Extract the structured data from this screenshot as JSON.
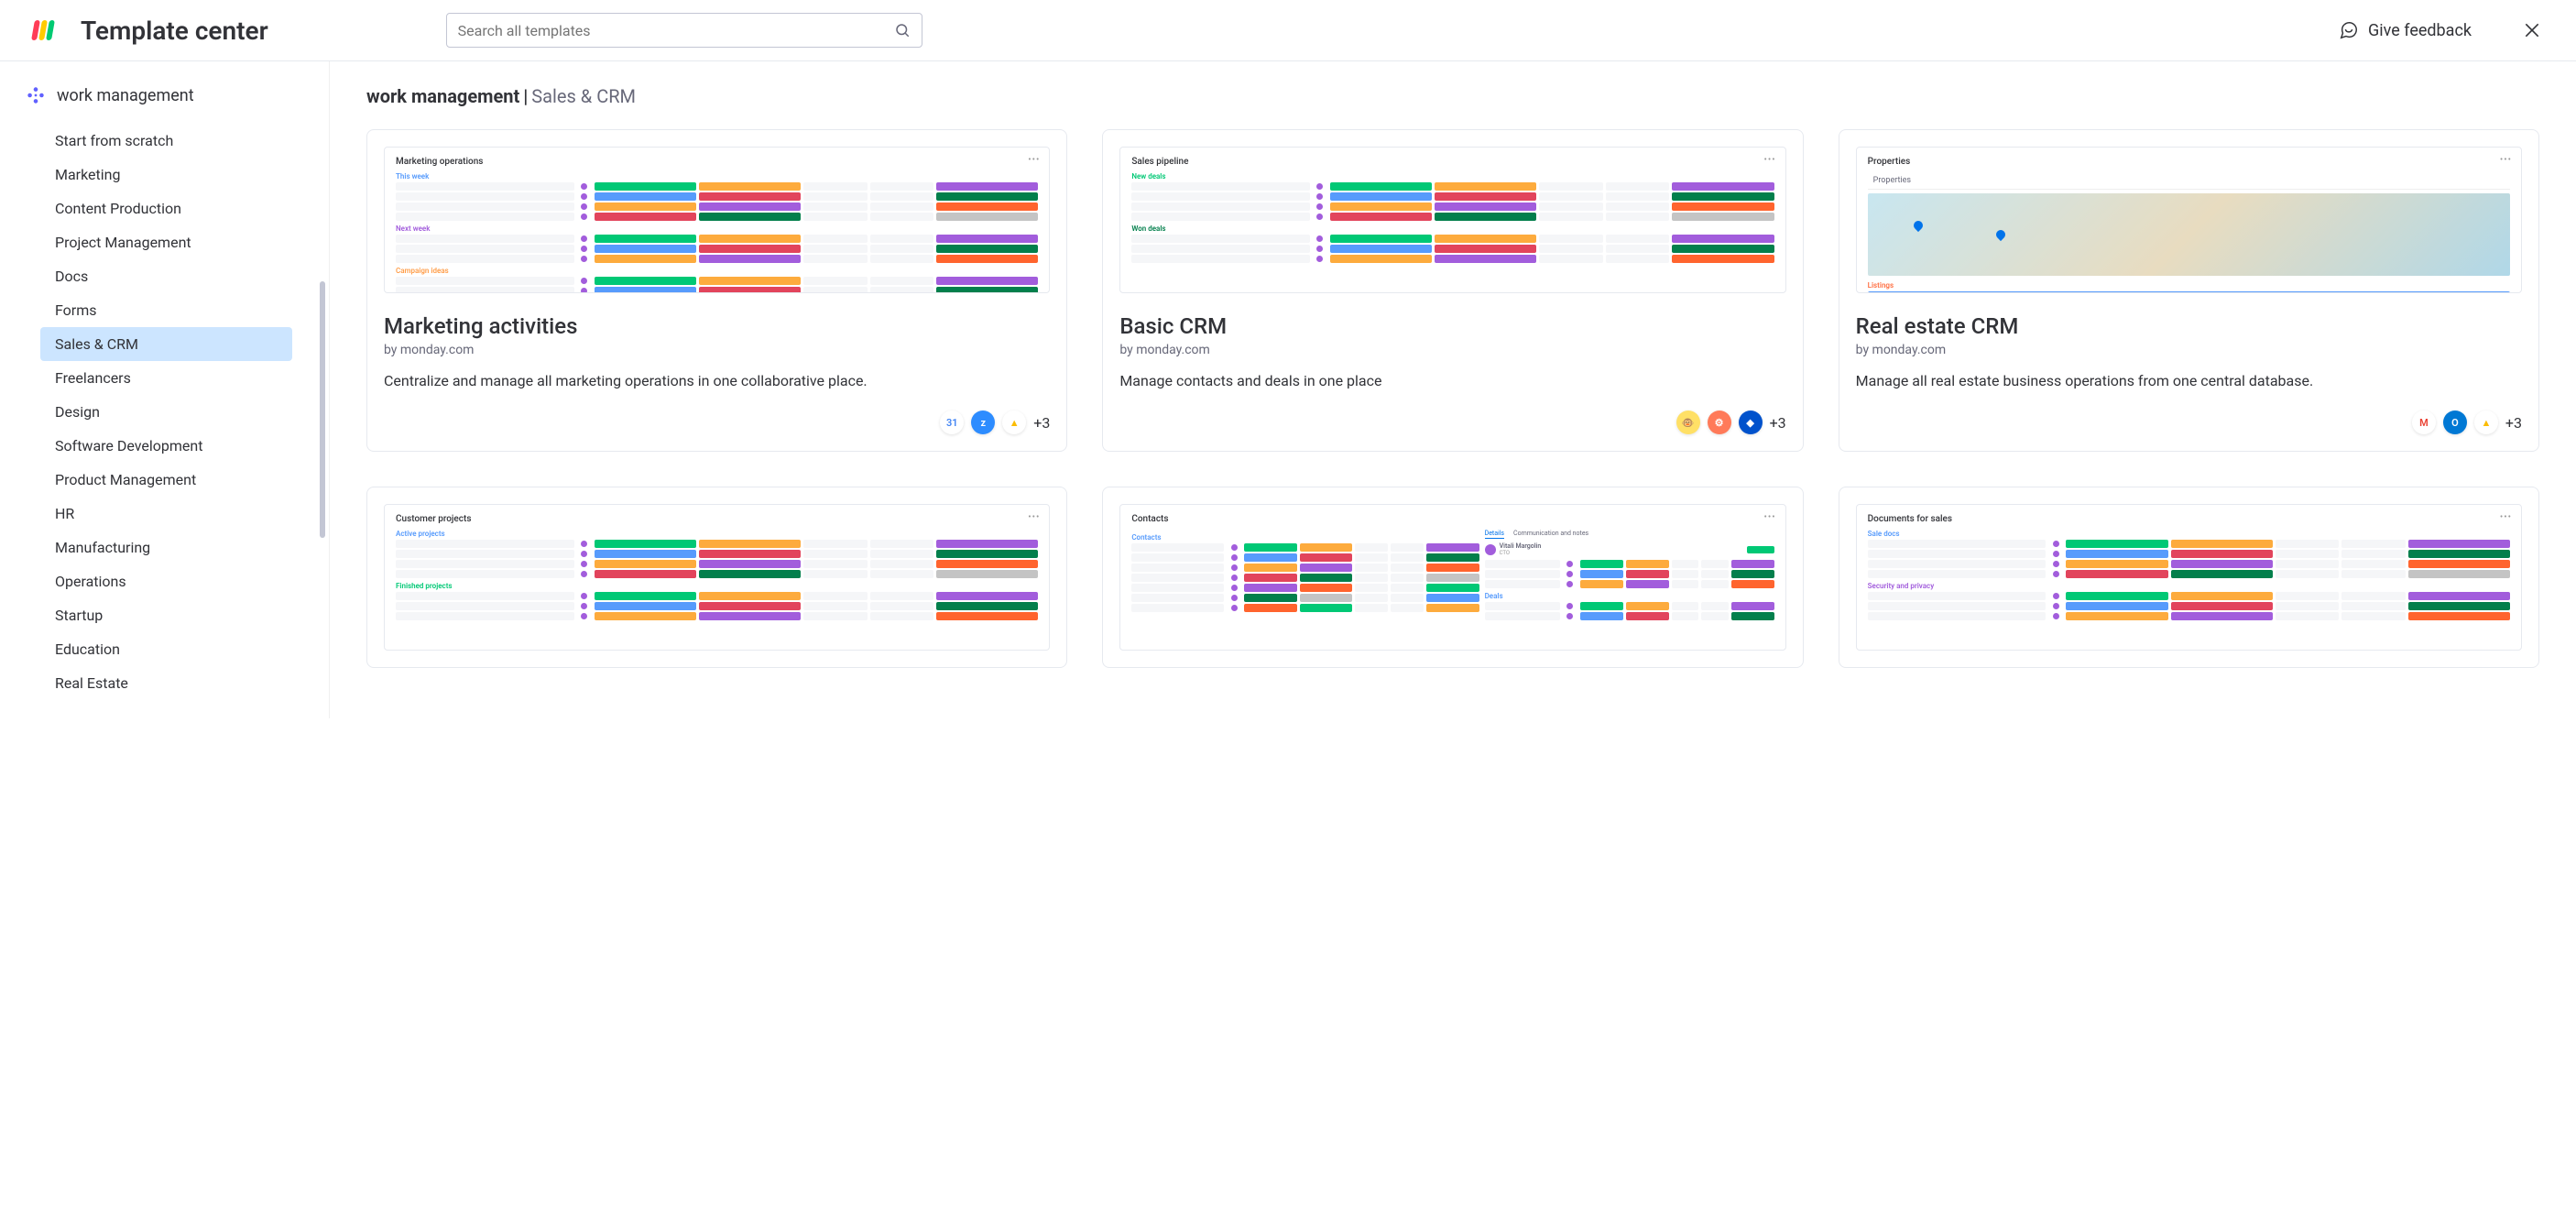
{
  "header": {
    "title": "Template center",
    "search_placeholder": "Search all templates",
    "feedback_label": "Give feedback"
  },
  "sidebar": {
    "section_title": "work management",
    "items": [
      {
        "label": "Start from scratch",
        "active": false
      },
      {
        "label": "Marketing",
        "active": false
      },
      {
        "label": "Content Production",
        "active": false
      },
      {
        "label": "Project Management",
        "active": false
      },
      {
        "label": "Docs",
        "active": false
      },
      {
        "label": "Forms",
        "active": false
      },
      {
        "label": "Sales & CRM",
        "active": true
      },
      {
        "label": "Freelancers",
        "active": false
      },
      {
        "label": "Design",
        "active": false
      },
      {
        "label": "Software Development",
        "active": false
      },
      {
        "label": "Product Management",
        "active": false
      },
      {
        "label": "HR",
        "active": false
      },
      {
        "label": "Manufacturing",
        "active": false
      },
      {
        "label": "Operations",
        "active": false
      },
      {
        "label": "Startup",
        "active": false
      },
      {
        "label": "Education",
        "active": false
      },
      {
        "label": "Real Estate",
        "active": false
      }
    ]
  },
  "breadcrumb": {
    "section": "work management",
    "category": "Sales & CRM"
  },
  "cards": [
    {
      "title": "Marketing activities",
      "by": "by monday.com",
      "desc": "Centralize and manage all marketing operations in one collaborative place.",
      "preview_title": "Marketing operations",
      "groups": [
        {
          "name": "This week",
          "color": "#579bfc"
        },
        {
          "name": "Next week",
          "color": "#a25ddc"
        },
        {
          "name": "Campaign ideas",
          "color": "#ff9d48"
        }
      ],
      "more": "+3"
    },
    {
      "title": "Basic CRM",
      "by": "by monday.com",
      "desc": "Manage contacts and deals in one place",
      "preview_title": "Sales pipeline",
      "groups": [
        {
          "name": "New deals",
          "color": "#00c875"
        },
        {
          "name": "Won deals",
          "color": "#037f4c"
        }
      ],
      "more": "+3"
    },
    {
      "title": "Real estate CRM",
      "by": "by monday.com",
      "desc": "Manage all real estate business operations from one central database.",
      "preview_title": "Properties",
      "preview_type": "map",
      "listings": "Listings",
      "more": "+3"
    },
    {
      "title": "",
      "by": "",
      "desc": "",
      "preview_title": "Customer projects",
      "groups": [
        {
          "name": "Active projects",
          "color": "#579bfc"
        },
        {
          "name": "Finished projects",
          "color": "#00c875"
        }
      ]
    },
    {
      "title": "",
      "by": "",
      "desc": "",
      "preview_title": "Contacts",
      "preview_type": "contacts",
      "groups": [
        {
          "name": "Contacts",
          "color": "#579bfc"
        }
      ],
      "tabs": [
        "Details",
        "Communication and notes"
      ],
      "profile_name": "Vitali Margolin",
      "profile_role": "CTO",
      "deals_label": "Deals"
    },
    {
      "title": "",
      "by": "",
      "desc": "",
      "preview_title": "Documents for sales",
      "groups": [
        {
          "name": "Sale docs",
          "color": "#579bfc"
        },
        {
          "name": "Security and privacy",
          "color": "#a25ddc"
        }
      ]
    }
  ],
  "colors": {
    "logo": [
      "#ff3d57",
      "#ffcb00",
      "#00ca72"
    ],
    "pills": [
      "#00c875",
      "#579bfc",
      "#fdab3d",
      "#e2445c",
      "#a25ddc",
      "#037f4c",
      "#ff642e",
      "#c4c4c4"
    ]
  }
}
